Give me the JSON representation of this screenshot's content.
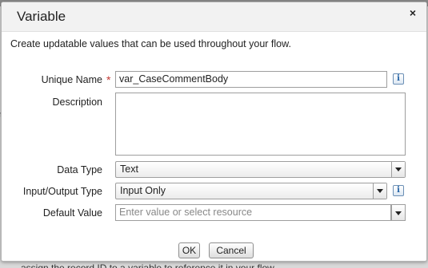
{
  "background": {
    "text": "assign the record ID to a variable to reference it in your flow."
  },
  "dialog": {
    "title": "Variable",
    "close_label": "×",
    "description": "Create updatable values that can be used throughout your flow.",
    "fields": {
      "unique_name": {
        "label": "Unique Name",
        "required_marker": "*",
        "value": "var_CaseCommentBody"
      },
      "description": {
        "label": "Description",
        "value": ""
      },
      "data_type": {
        "label": "Data Type",
        "selected": "Text"
      },
      "io_type": {
        "label": "Input/Output Type",
        "selected": "Input Only"
      },
      "default_value": {
        "label": "Default Value",
        "value": "",
        "placeholder": "Enter value or select resource"
      }
    },
    "info_icon_glyph": "i",
    "buttons": {
      "ok": "OK",
      "cancel": "Cancel"
    }
  },
  "colors": {
    "required": "#c23934",
    "info_icon": "#1f5fa3",
    "header_bg": "#f2f2f2"
  }
}
